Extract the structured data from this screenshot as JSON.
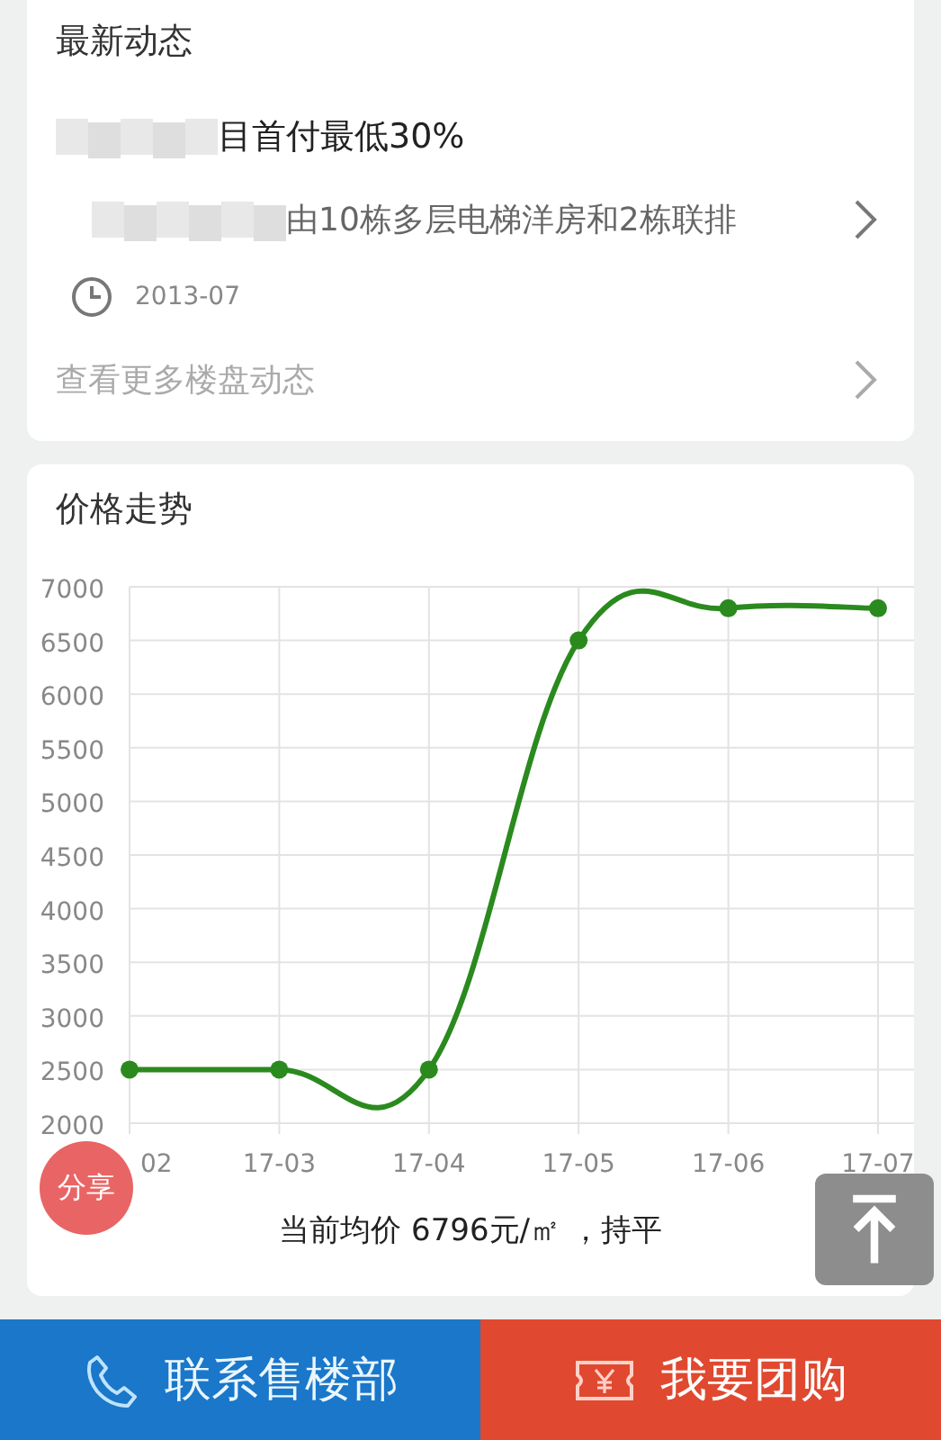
{
  "news": {
    "title": "最新动态",
    "items": [
      {
        "headline": "目首付最低30%",
        "summary": "由10栋多层电梯洋房和2栋联排",
        "date": "2013-07"
      }
    ],
    "more_link": "查看更多楼盘动态"
  },
  "price_trend": {
    "title": "价格走势",
    "chart_data": {
      "type": "line",
      "categories": [
        "02",
        "17-03",
        "17-04",
        "17-05",
        "17-06",
        "17-07"
      ],
      "grid": true,
      "series": [
        {
          "color": "#2a8a1e",
          "marker": true,
          "values": [
            2500,
            2500,
            2500,
            6500,
            6800,
            6800
          ]
        }
      ],
      "ylim": [
        2000,
        7000
      ],
      "yticks": [
        2000,
        2500,
        3000,
        3500,
        4000,
        4500,
        5000,
        5500,
        6000,
        6500,
        7000
      ]
    },
    "summary": "当前均价 6796元/㎡ ，持平"
  },
  "share_button": "分享",
  "actions": [
    {
      "kind": "call",
      "label": "联系售楼部"
    },
    {
      "kind": "group_buy",
      "label": "我要团购"
    }
  ]
}
